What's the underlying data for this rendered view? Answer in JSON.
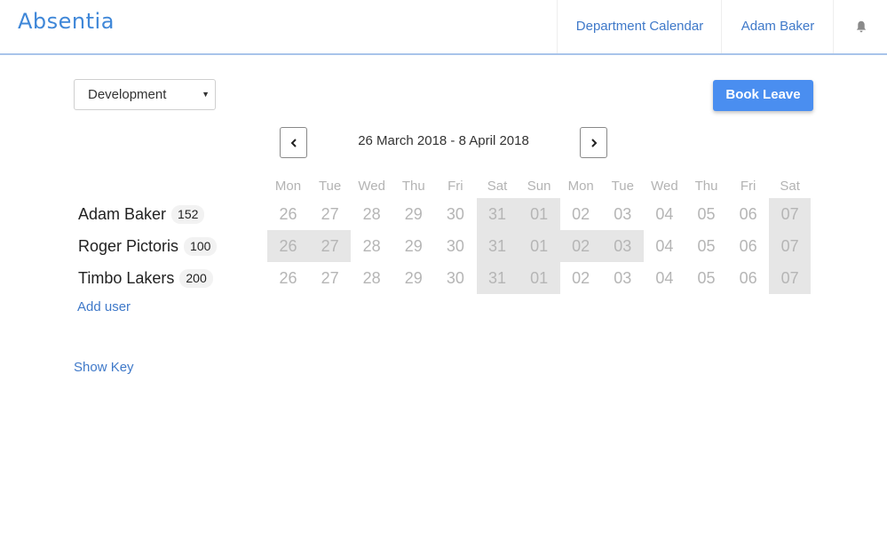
{
  "app": {
    "brand": "Absentia"
  },
  "header": {
    "nav_department_calendar": "Department Calendar",
    "nav_user": "Adam Baker",
    "bell_icon": "bell-icon"
  },
  "controls": {
    "department_selected": "Development",
    "book_leave_label": "Book Leave",
    "prev_label": "‹",
    "next_label": "›",
    "date_range": "26 March 2018 - 8 April 2018"
  },
  "calendar": {
    "day_headers": [
      "Mon",
      "Tue",
      "Wed",
      "Thu",
      "Fri",
      "Sat",
      "Sun",
      "Mon",
      "Tue",
      "Wed",
      "Thu",
      "Fri",
      "Sat"
    ],
    "dates": [
      "26",
      "27",
      "28",
      "29",
      "30",
      "31",
      "01",
      "02",
      "03",
      "04",
      "05",
      "06",
      "07"
    ]
  },
  "users": [
    {
      "name": "Adam Baker",
      "days_count": "152",
      "shaded_day_indices": [
        5,
        6,
        12
      ]
    },
    {
      "name": "Roger Pictoris",
      "days_count": "100",
      "shaded_day_indices": [
        0,
        1,
        5,
        6,
        7,
        8,
        12
      ]
    },
    {
      "name": "Timbo Lakers",
      "days_count": "200",
      "shaded_day_indices": [
        5,
        6,
        12
      ]
    }
  ],
  "links": {
    "add_user": "Add user",
    "show_key": "Show Key"
  },
  "colors": {
    "brand": "#3f87d8",
    "link": "#3f79c9",
    "primary_button": "#4a8ef0",
    "shaded_cell": "#e6e6e6"
  }
}
